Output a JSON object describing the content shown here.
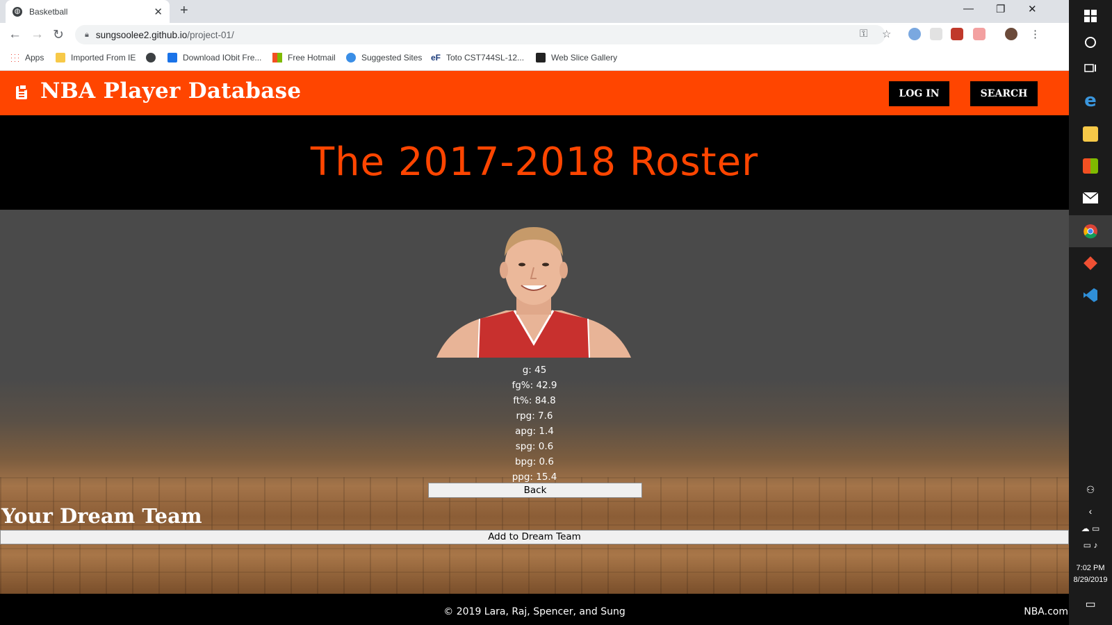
{
  "browser": {
    "tab_title": "Basketball",
    "url_host": "sungsoolee2.github.io",
    "url_path": "/project-01/",
    "bookmarks": [
      "Apps",
      "Imported From IE",
      "Download IObit Fre...",
      "Free Hotmail",
      "Suggested Sites",
      "Toto CST744SL-12...",
      "Web Slice Gallery"
    ]
  },
  "site": {
    "brand": "NBA Player Database",
    "login_label": "LOG IN",
    "search_label": "SEARCH",
    "heading": "The 2017-2018 Roster",
    "stats": [
      "g: 45",
      "fg%: 42.9",
      "ft%: 84.8",
      "rpg: 7.6",
      "apg: 1.4",
      "spg: 0.6",
      "bpg: 0.6",
      "ppg: 15.4"
    ],
    "back_label": "Back",
    "dream_team_heading": "Your Dream Team",
    "add_label": "Add to Dream Team",
    "footer_copy": "© 2019 Lara, Raj, Spencer, and Sung",
    "footer_link": "NBA.com"
  },
  "colors": {
    "brand_orange": "#ff4500",
    "hero_bg": "#000000",
    "court_wood": "#a47449"
  },
  "taskbar": {
    "time": "7:02 PM",
    "date": "8/29/2019",
    "icons": [
      "windows-start-icon",
      "cortana-icon",
      "task-view-icon",
      "edge-icon",
      "file-explorer-icon",
      "store-icon",
      "mail-icon",
      "chrome-icon",
      "git-icon",
      "vscode-icon"
    ]
  }
}
